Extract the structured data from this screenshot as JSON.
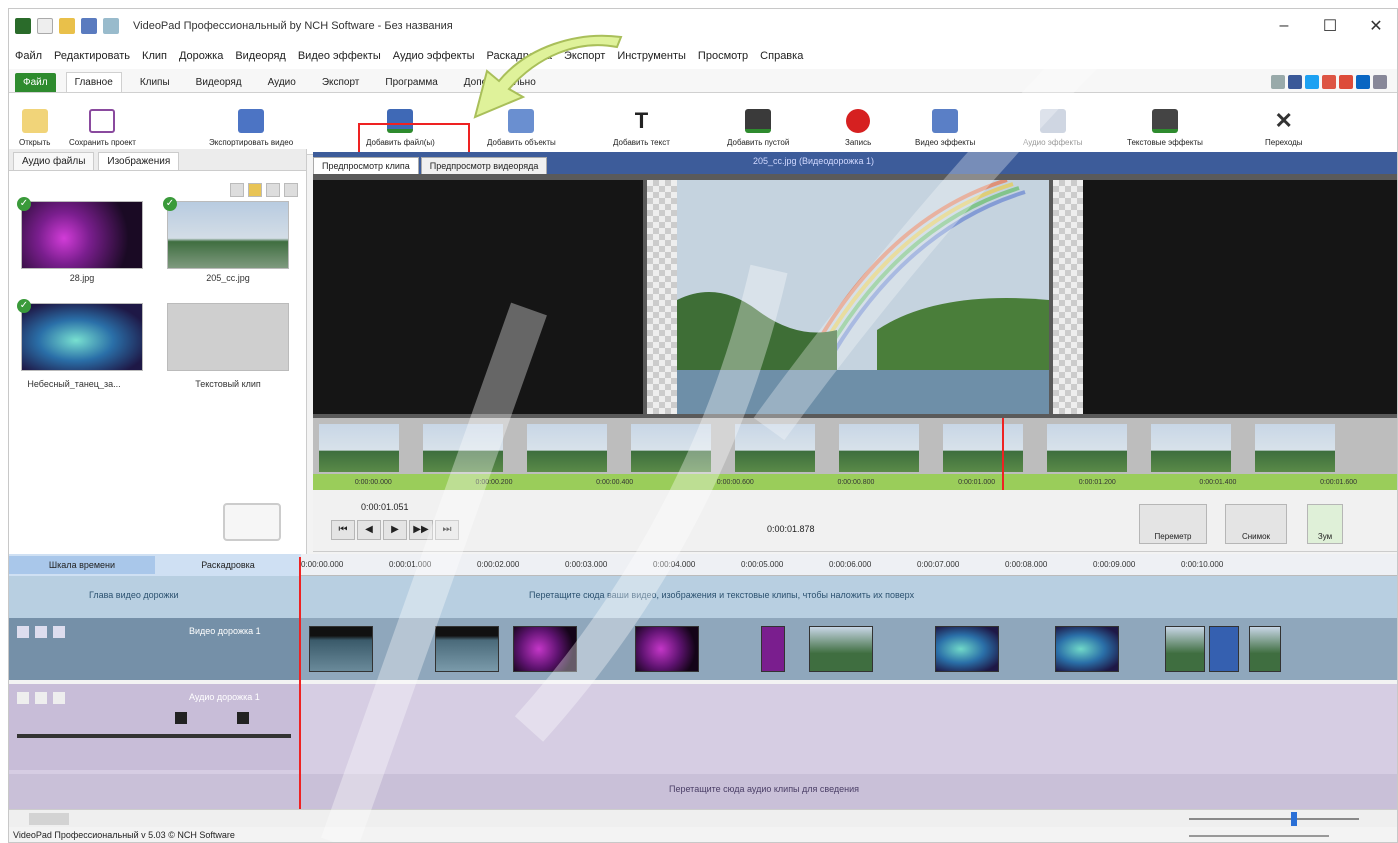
{
  "window": {
    "title": "VideoPad Профессиональный by NCH Software - Без названия",
    "controls": [
      "–",
      "☐",
      "✕"
    ]
  },
  "menu": {
    "items": [
      "Файл",
      "Редактировать",
      "Клип",
      "Дорожка",
      "Видеоряд",
      "Видео эффекты",
      "Аудио эффекты",
      "Раскадровка",
      "Экспорт",
      "Инструменты",
      "Просмотр",
      "Справка"
    ]
  },
  "ribbon": {
    "tabs": [
      "Файл",
      "Главное",
      "Клипы",
      "Видеоряд",
      "Аудио",
      "Экспорт",
      "Программа",
      "Дополнительно"
    ],
    "active_tab": 1
  },
  "toolbar": {
    "open": "Открыть",
    "save": "Сохранить проект",
    "export": "Экспортировать видео",
    "add_files": "Добавить файл(ы)",
    "add_objects": "Добавить объекты",
    "add_text": "Добавить текст",
    "add_blank": "Добавить пустой",
    "record": "Запись",
    "video_effects": "Видео эффекты",
    "audio_effects": "Аудио эффекты",
    "text_effects": "Текстовые эффекты",
    "transitions": "Переходы"
  },
  "bin": {
    "tabs": [
      "Аудио файлы",
      "Изображения"
    ],
    "items": [
      {
        "name": "28.jpg"
      },
      {
        "name": "205_cc.jpg"
      },
      {
        "name": "Небесный_танец_за..."
      },
      {
        "name": "Текстовый клип"
      }
    ]
  },
  "preview": {
    "tabs": [
      "Предпросмотр клипа",
      "Предпросмотр видеоряда"
    ],
    "title": "205_cc.jpg (Видеодорожка 1)"
  },
  "filmstrip": {
    "times": [
      "0:00:00.000",
      "0:00:00.200",
      "0:00:00.400",
      "0:00:00.600",
      "0:00:00.800",
      "0:00:01.000",
      "0:00:01.200",
      "0:00:01.400",
      "0:00:01.600"
    ]
  },
  "transport": {
    "current": "0:00:01.051",
    "duration": "0:00:01.878",
    "buttons": [
      "⏮",
      "◀",
      "▶",
      "▶▶",
      "⏭"
    ],
    "right": [
      "Переметр",
      "Снимок",
      "Зум"
    ]
  },
  "timeline": {
    "tabs": [
      "Шкала времени",
      "Раскадровка"
    ],
    "ruler": [
      "0:00:00.000",
      "0:00:01.000",
      "0:00:02.000",
      "0:00:03.000",
      "0:00:04.000",
      "0:00:05.000",
      "0:00:06.000",
      "0:00:07.000",
      "0:00:08.000",
      "0:00:09.000",
      "0:00:10.000"
    ],
    "video_hint_left": "Глава видео дорожки",
    "video_hint": "Перетащите сюда ваши видео, изображения и текстовые клипы, чтобы наложить их поверх",
    "video_track": "Видео дорожка 1",
    "audio_track": "Аудио дорожка 1",
    "audio_hint": "Перетащите сюда аудио клипы для сведения"
  },
  "status": {
    "text": "VideoPad Профессиональный v 5.03 © NCH Software"
  },
  "colors": {
    "accent": "#3d5c9a",
    "highlight": "#e22222",
    "file_tab": "#2e8b2e"
  }
}
